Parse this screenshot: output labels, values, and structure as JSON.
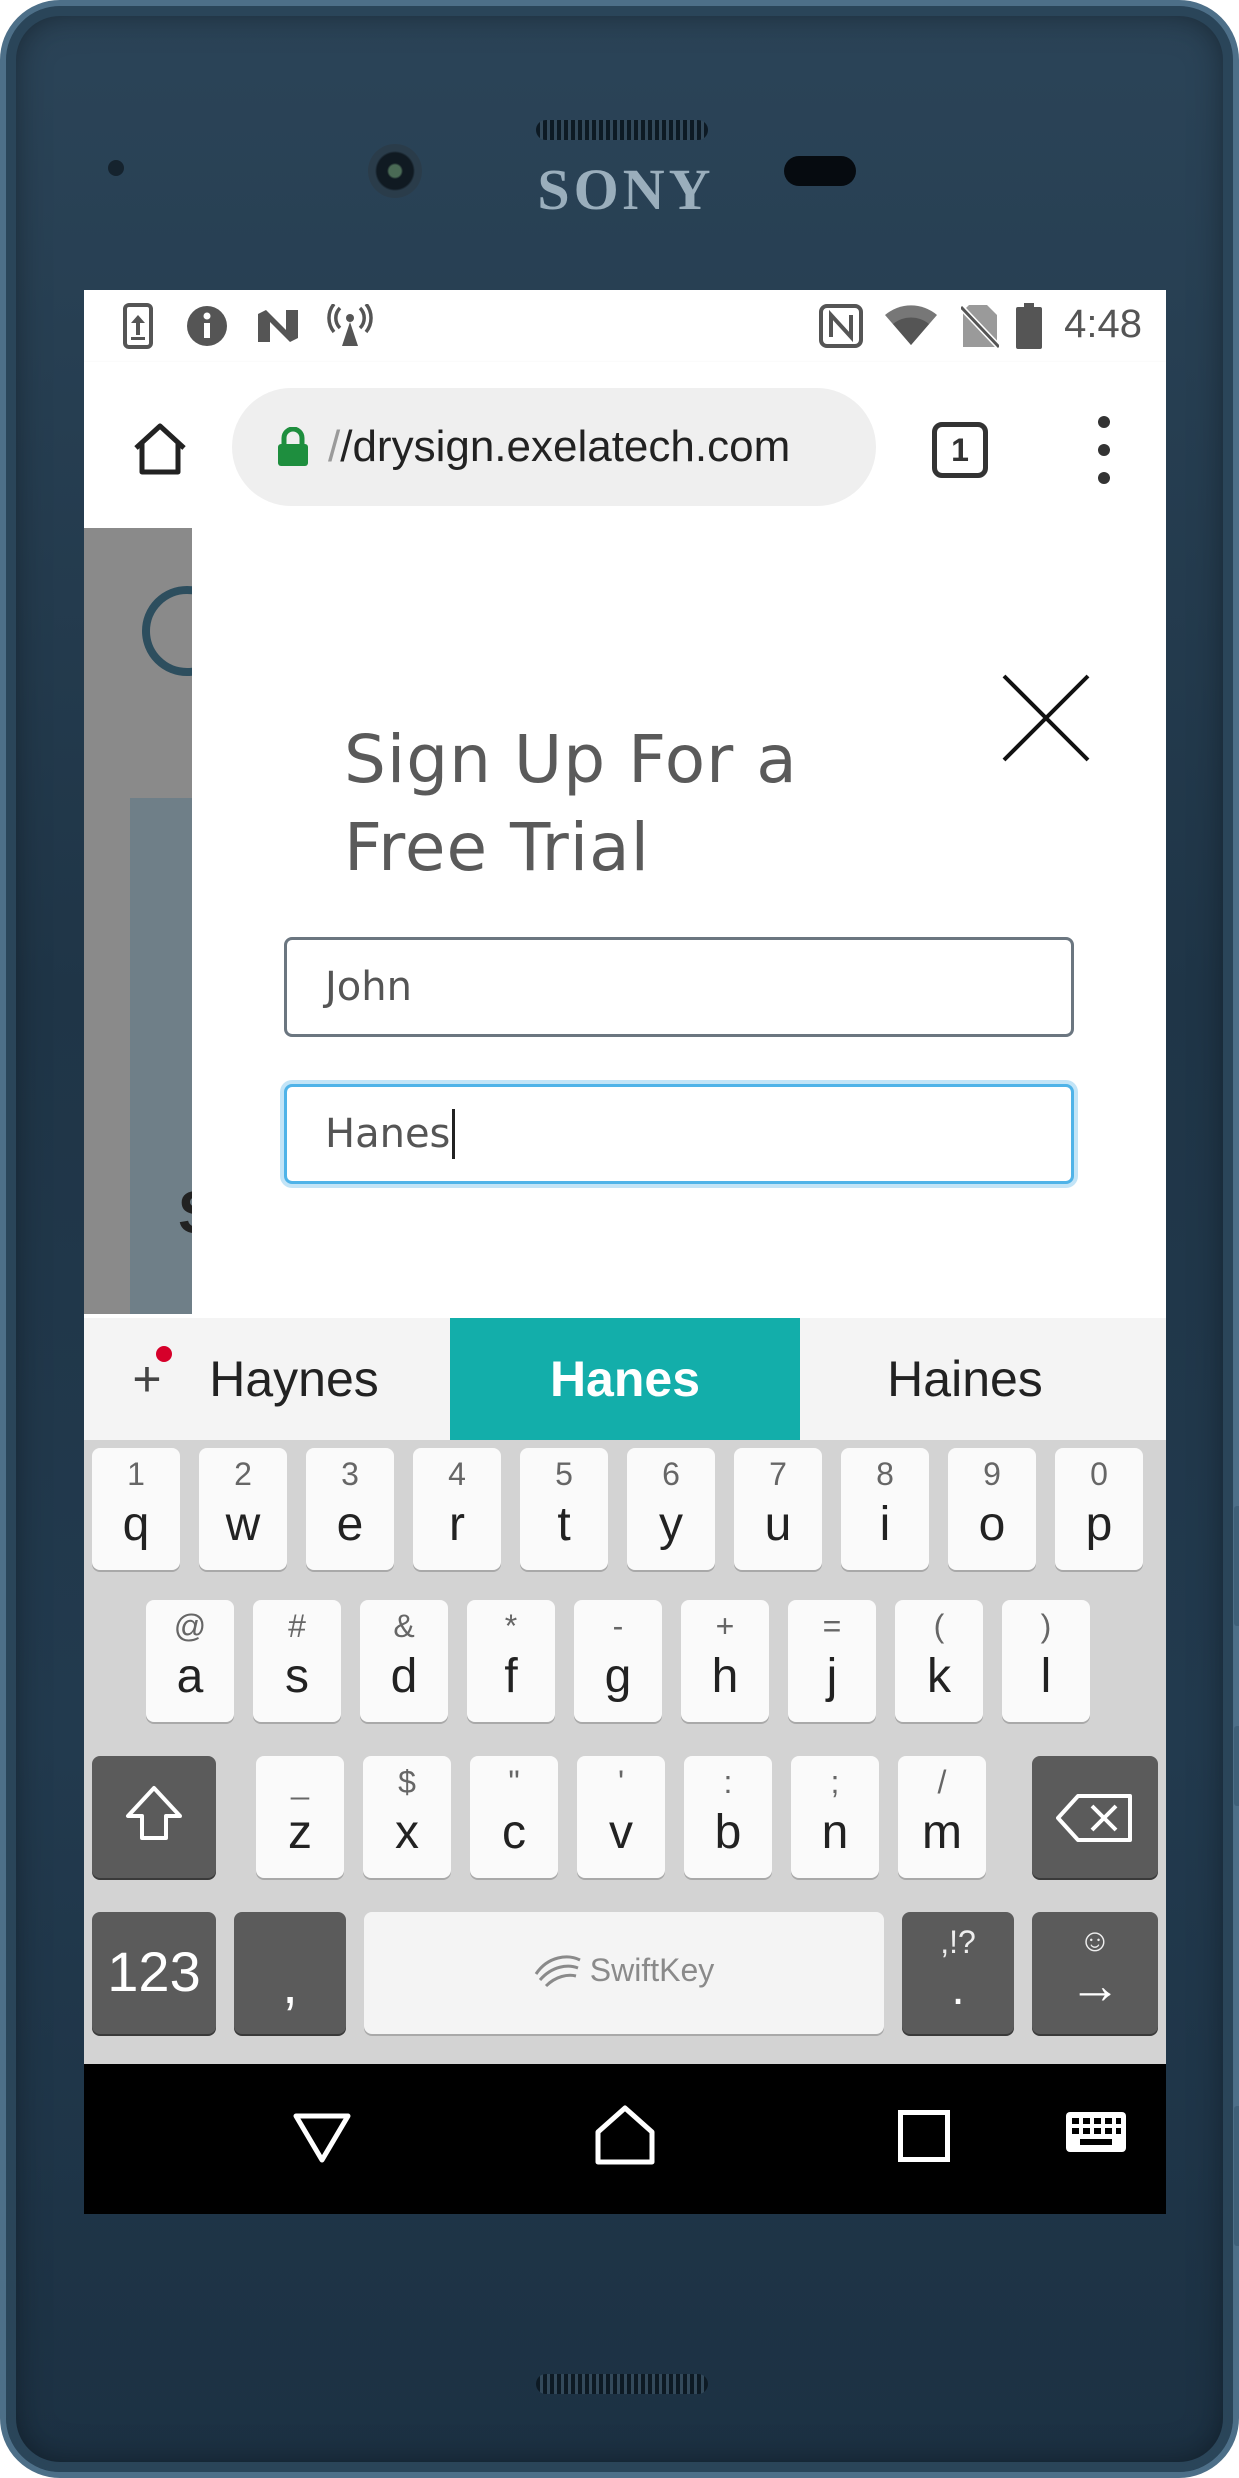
{
  "device": {
    "brand": "SONY"
  },
  "status_bar": {
    "time": "4:48",
    "left_icons": [
      "upload-icon",
      "info-icon",
      "n-notification-icon",
      "hotspot-icon"
    ],
    "right_icons": [
      "nfc-icon",
      "wifi-icon",
      "no-sim-icon",
      "battery-icon"
    ]
  },
  "browser": {
    "url_prefix": "/",
    "url": "/drysign.exelatech.com",
    "tab_count": "1",
    "lock_color": "#1e8e3e"
  },
  "modal": {
    "title_line1": "Sign Up For a",
    "title_line2": "Free Trial",
    "first_name_value": "John",
    "last_name_value": "Hanes"
  },
  "keyboard": {
    "suggestions": [
      "Haynes",
      "Hanes",
      "Haines"
    ],
    "active_suggestion_index": 1,
    "accent_color": "#13aeaa",
    "row1": [
      {
        "main": "q",
        "sub": "1"
      },
      {
        "main": "w",
        "sub": "2"
      },
      {
        "main": "e",
        "sub": "3"
      },
      {
        "main": "r",
        "sub": "4"
      },
      {
        "main": "t",
        "sub": "5"
      },
      {
        "main": "y",
        "sub": "6"
      },
      {
        "main": "u",
        "sub": "7"
      },
      {
        "main": "i",
        "sub": "8"
      },
      {
        "main": "o",
        "sub": "9"
      },
      {
        "main": "p",
        "sub": "0"
      }
    ],
    "row2": [
      {
        "main": "a",
        "sub": "@"
      },
      {
        "main": "s",
        "sub": "#"
      },
      {
        "main": "d",
        "sub": "&"
      },
      {
        "main": "f",
        "sub": "*"
      },
      {
        "main": "g",
        "sub": "-"
      },
      {
        "main": "h",
        "sub": "+"
      },
      {
        "main": "j",
        "sub": "="
      },
      {
        "main": "k",
        "sub": "("
      },
      {
        "main": "l",
        "sub": ")"
      }
    ],
    "row3": [
      {
        "main": "z",
        "sub": "_"
      },
      {
        "main": "x",
        "sub": "$"
      },
      {
        "main": "c",
        "sub": "\""
      },
      {
        "main": "v",
        "sub": "'"
      },
      {
        "main": "b",
        "sub": ":"
      },
      {
        "main": "n",
        "sub": ";"
      },
      {
        "main": "m",
        "sub": "/"
      }
    ],
    "numbers_key": "123",
    "comma_key": ",",
    "space_label": "SwiftKey",
    "period_key": ".",
    "period_sub": ",!?",
    "enter_sub": "☺",
    "enter_main": "→"
  },
  "nav_bar": {
    "icons": [
      "back-icon",
      "home-icon",
      "recents-icon",
      "keyboard-switch-icon"
    ]
  }
}
